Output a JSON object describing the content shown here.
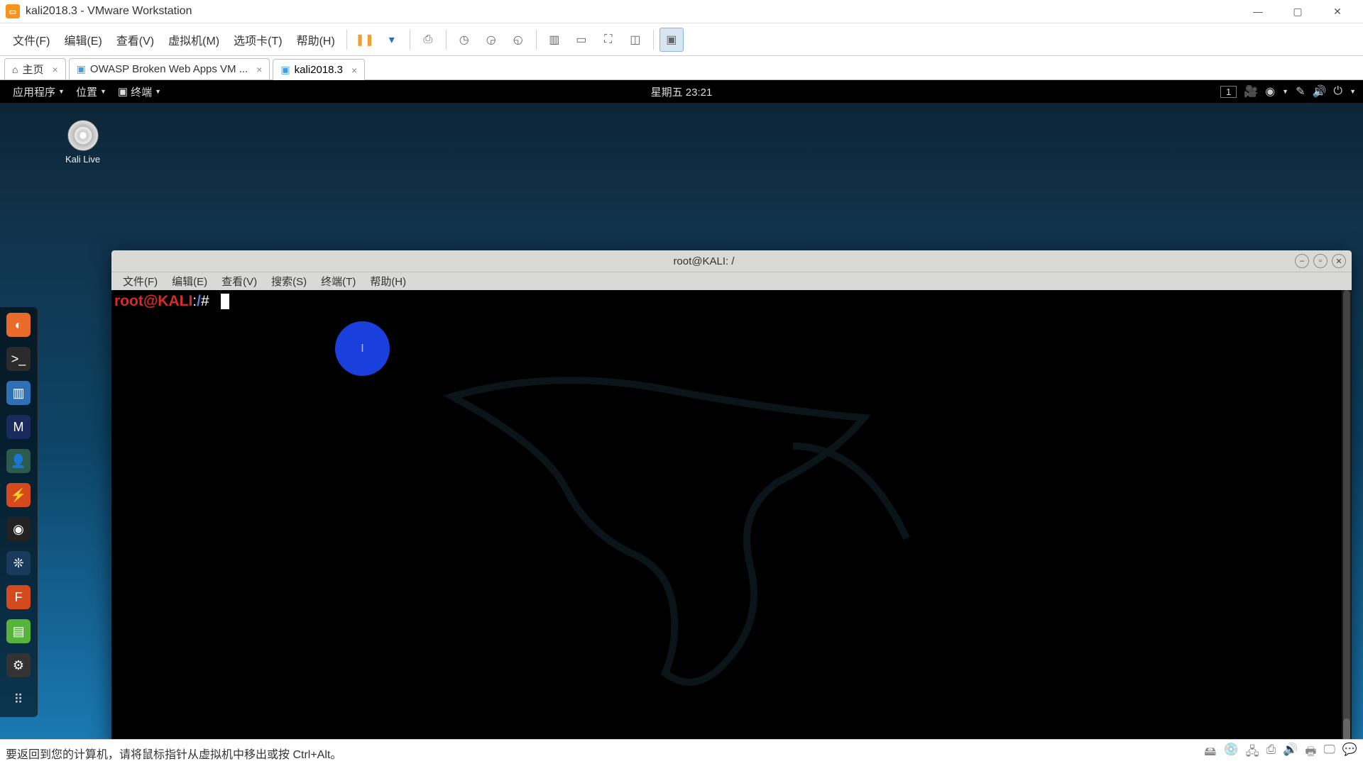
{
  "host": {
    "title": "kali2018.3 - VMware Workstation",
    "menu": [
      "文件(F)",
      "编辑(E)",
      "查看(V)",
      "虚拟机(M)",
      "选项卡(T)",
      "帮助(H)"
    ],
    "tabs": [
      {
        "label": "主页",
        "active": false
      },
      {
        "label": "OWASP Broken Web Apps VM ...",
        "active": false
      },
      {
        "label": "kali2018.3",
        "active": true
      }
    ],
    "status_hint": "要返回到您的计算机，请将鼠标指针从虚拟机中移出或按 Ctrl+Alt。"
  },
  "guest": {
    "topbar": {
      "apps": "应用程序",
      "places": "位置",
      "terminal_label": "终端",
      "clock": "星期五 23:21",
      "workspace": "1"
    },
    "desk_icon_label": "Kali Live",
    "terminal": {
      "title": "root@KALI: /",
      "menu": [
        "文件(F)",
        "编辑(E)",
        "查看(V)",
        "搜索(S)",
        "终端(T)",
        "帮助(H)"
      ],
      "ps_user": "root@KALI",
      "ps_sep": ":",
      "ps_path": "/",
      "ps_prompt": "#"
    }
  },
  "cursor_glyph": "I"
}
